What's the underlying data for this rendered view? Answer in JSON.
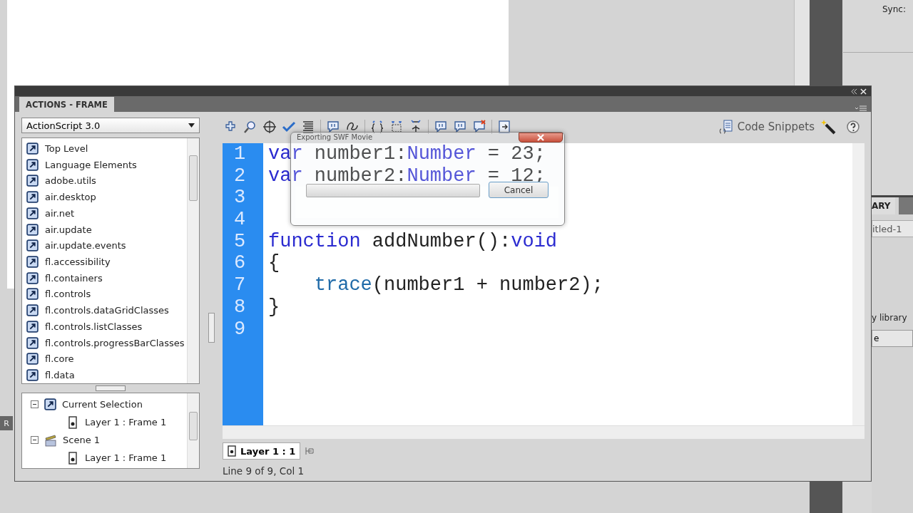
{
  "stage_panel": {
    "sync_label": "Sync:"
  },
  "library_panel": {
    "tab": "ARY",
    "document": "itled-1",
    "link": "y library",
    "button": "e"
  },
  "left_edge_label": "R",
  "actions_panel": {
    "title": "ACTIONS - FRAME",
    "language_select": "ActionScript 3.0",
    "code_snippets": "Code Snippets",
    "toolbox": [
      {
        "label": "Top Level"
      },
      {
        "label": "Language Elements"
      },
      {
        "label": "adobe.utils"
      },
      {
        "label": "air.desktop"
      },
      {
        "label": "air.net"
      },
      {
        "label": "air.update"
      },
      {
        "label": "air.update.events"
      },
      {
        "label": "fl.accessibility"
      },
      {
        "label": "fl.containers"
      },
      {
        "label": "fl.controls"
      },
      {
        "label": "fl.controls.dataGridClasses"
      },
      {
        "label": "fl.controls.listClasses"
      },
      {
        "label": "fl.controls.progressBarClasses"
      },
      {
        "label": "fl.core"
      },
      {
        "label": "fl.data"
      }
    ],
    "script_navigator": [
      {
        "label": "Current Selection",
        "kind": "selection",
        "expanded": true,
        "children": [
          {
            "label": "Layer 1 : Frame 1"
          }
        ]
      },
      {
        "label": "Scene 1",
        "kind": "scene",
        "expanded": true,
        "children": [
          {
            "label": "Layer 1 : Frame 1"
          }
        ]
      }
    ],
    "code_lines": [
      {
        "number": "1",
        "indented": false,
        "tokens": [
          {
            "kind": "keyword",
            "text": "var"
          },
          {
            "kind": "plain",
            "text": " number1:"
          },
          {
            "kind": "type",
            "text": "Number"
          },
          {
            "kind": "plain",
            "text": " = 23;"
          }
        ]
      },
      {
        "number": "2",
        "indented": false,
        "tokens": [
          {
            "kind": "keyword",
            "text": "var"
          },
          {
            "kind": "plain",
            "text": " number2:"
          },
          {
            "kind": "type",
            "text": "Number"
          },
          {
            "kind": "plain",
            "text": " = 12;"
          }
        ]
      },
      {
        "number": "3"
      },
      {
        "number": "4"
      },
      {
        "number": "5",
        "indented": false,
        "tokens": [
          {
            "kind": "keyword",
            "text": "function"
          },
          {
            "kind": "plain",
            "text": " addNumber():"
          },
          {
            "kind": "type",
            "text": "void"
          }
        ]
      },
      {
        "number": "6",
        "indented": false,
        "tokens": [
          {
            "kind": "plain",
            "text": "{"
          }
        ]
      },
      {
        "number": "7",
        "indented": true,
        "tokens": [
          {
            "kind": "builtin",
            "text": "trace"
          },
          {
            "kind": "plain",
            "text": "(number1 + number2);"
          }
        ]
      },
      {
        "number": "8",
        "indented": false,
        "tokens": [
          {
            "kind": "plain",
            "text": "}"
          }
        ]
      },
      {
        "number": "9"
      }
    ],
    "script_tab": {
      "label": "Layer 1 : 1"
    },
    "status": "Line 9 of 9, Col 1"
  },
  "export_dialog": {
    "title": "Exporting SWF Movie",
    "progress": {
      "level": 0
    },
    "cancel": "Cancel"
  }
}
